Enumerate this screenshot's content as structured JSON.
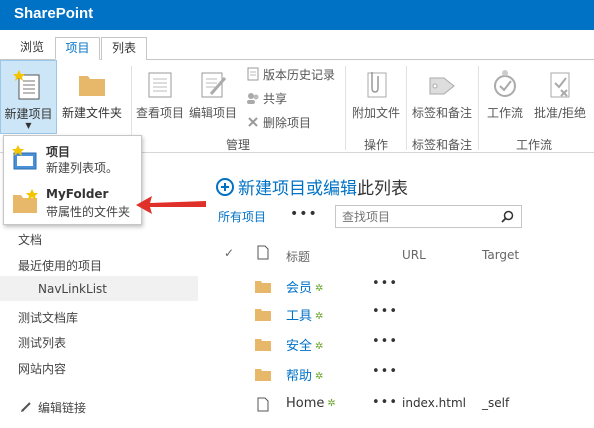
{
  "suitebar": {
    "brand": "SharePoint"
  },
  "tabs": [
    {
      "label": "浏览"
    },
    {
      "label": "项目"
    },
    {
      "label": "列表"
    }
  ],
  "ribbon": {
    "new_item": "新建项目",
    "new_folder": "新建文件夹",
    "view_item": "查看项目",
    "edit_item": "编辑项目",
    "version_history": "版本历史记录",
    "share": "共享",
    "delete_item": "删除项目",
    "manage_group": "管理",
    "attach_file": "附加文件",
    "actions_group": "操作",
    "tags_notes": "标签和备注",
    "tags_group": "标签和备注",
    "workflows": "工作流",
    "approve_reject": "批准/拒绝",
    "workflow_group": "工作流"
  },
  "dropdown": {
    "items": [
      {
        "title": "项目",
        "desc": "新建列表项。"
      },
      {
        "title": "MyFolder",
        "desc": "带属性的文件夹"
      }
    ]
  },
  "nav": {
    "items": [
      {
        "label": "文档"
      },
      {
        "label": "最近使用的项目"
      },
      {
        "label": "NavLinkList"
      },
      {
        "label": "测试文档库"
      },
      {
        "label": "测试列表"
      },
      {
        "label": "网站内容"
      }
    ],
    "edit_links": "编辑链接"
  },
  "main": {
    "new_item_prefix": "新建项目或",
    "new_item_edit": "编辑",
    "new_item_suffix": "此列表",
    "view_all": "所有项目",
    "view_menu": "•••",
    "search_placeholder": "查找项目",
    "columns": {
      "title": "标题",
      "url": "URL",
      "target": "Target"
    },
    "rows": [
      {
        "title": "会员",
        "type": "folder",
        "url": "",
        "target": ""
      },
      {
        "title": "工具",
        "type": "folder",
        "url": "",
        "target": ""
      },
      {
        "title": "安全",
        "type": "folder",
        "url": "",
        "target": ""
      },
      {
        "title": "帮助",
        "type": "folder",
        "url": "",
        "target": ""
      },
      {
        "title": "Home",
        "type": "item",
        "url": "index.html",
        "target": "_self"
      }
    ],
    "row_menu": "•••",
    "new_marker": "✲"
  },
  "colors": {
    "accent": "#0072c6",
    "arrow": "#e0302a",
    "folder": "#e8b86a",
    "new_badge": "#6aa32d"
  }
}
